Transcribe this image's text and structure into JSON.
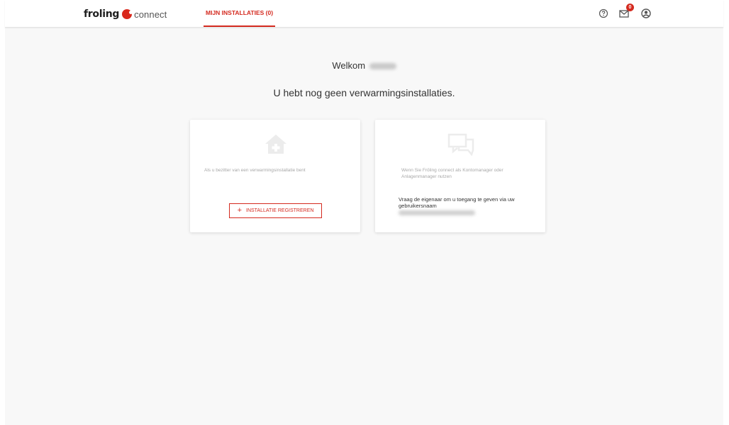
{
  "header": {
    "logo_word": "froling",
    "logo_connect": "connect",
    "tab_label": "MIJN INSTALLATIES (0)",
    "icons": [
      "help-icon",
      "mail-icon",
      "account-icon"
    ],
    "mail_badge": "0",
    "accent_color": "#d42a1f"
  },
  "main": {
    "welcome_label": "Welkom",
    "empty_message": "U hebt nog geen verwarmingsinstallaties."
  },
  "cards": {
    "owner": {
      "icon": "home-add-icon",
      "description": "Als u bezitter van een verwarmingsinstallatie bent",
      "button_label": "INSTALLATIE REGISTREREN"
    },
    "manager": {
      "icon": "chat-icon",
      "description": "Wenn Sie Fröling connect als Kontomanager oder Anlagenmanager nutzen",
      "instruction": "Vraag de eigenaar om u toegang te geven via uw gebruikersnaam"
    }
  }
}
